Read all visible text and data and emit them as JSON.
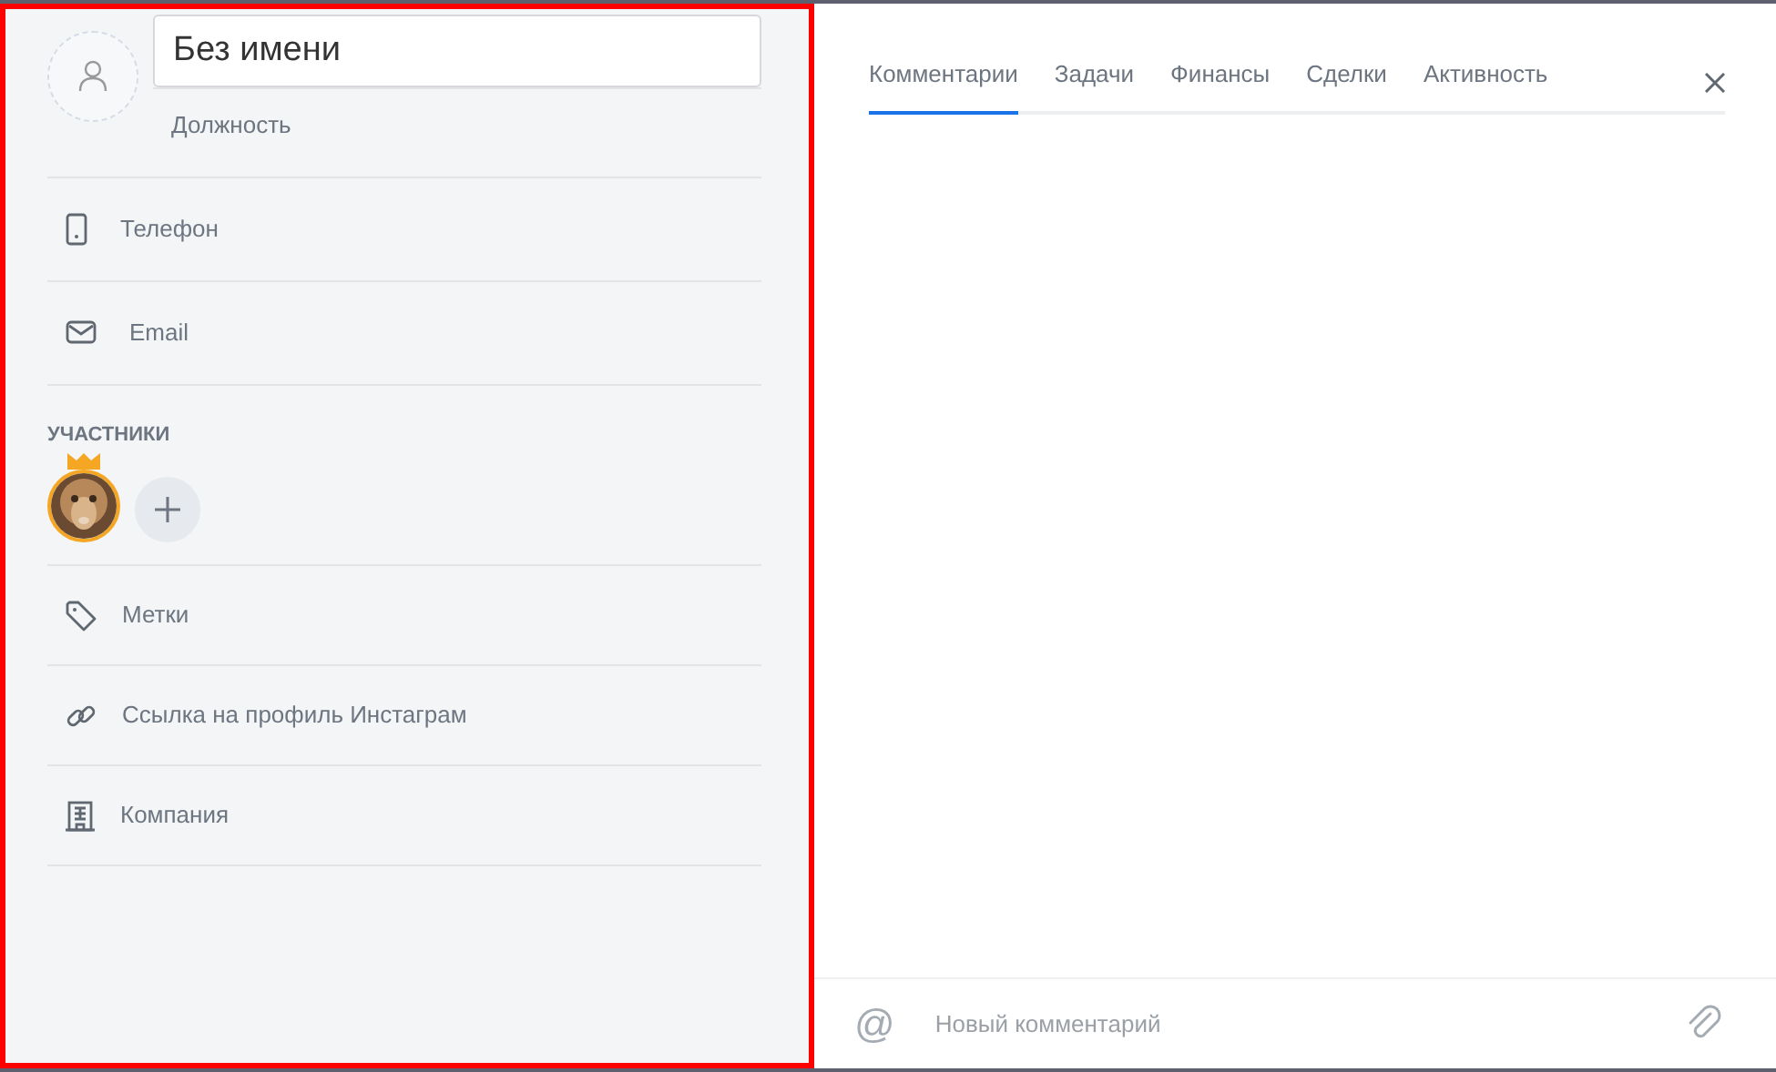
{
  "contact": {
    "name": "Без имени",
    "position_placeholder": "Должность"
  },
  "fields": [
    {
      "kind": "phone",
      "label": "Телефон"
    },
    {
      "kind": "email",
      "label": "Email"
    }
  ],
  "participants": {
    "heading": "УЧАСТНИКИ",
    "members": [
      {
        "kind": "picture",
        "owner": true
      }
    ]
  },
  "extra_fields": [
    {
      "kind": "tag",
      "label": "Метки"
    },
    {
      "kind": "link",
      "label": "Ссылка на профиль Инстаграм"
    },
    {
      "kind": "company",
      "label": "Компания"
    }
  ],
  "tabs": [
    {
      "label": "Комментарии",
      "selected": true
    },
    {
      "label": "Задачи",
      "selected": false
    },
    {
      "label": "Финансы",
      "selected": false
    },
    {
      "label": "Сделки",
      "selected": false
    },
    {
      "label": "Активность",
      "selected": false
    }
  ],
  "comment_box": {
    "mention_symbol": "@",
    "placeholder": "Новый комментарий"
  },
  "highlight": true
}
